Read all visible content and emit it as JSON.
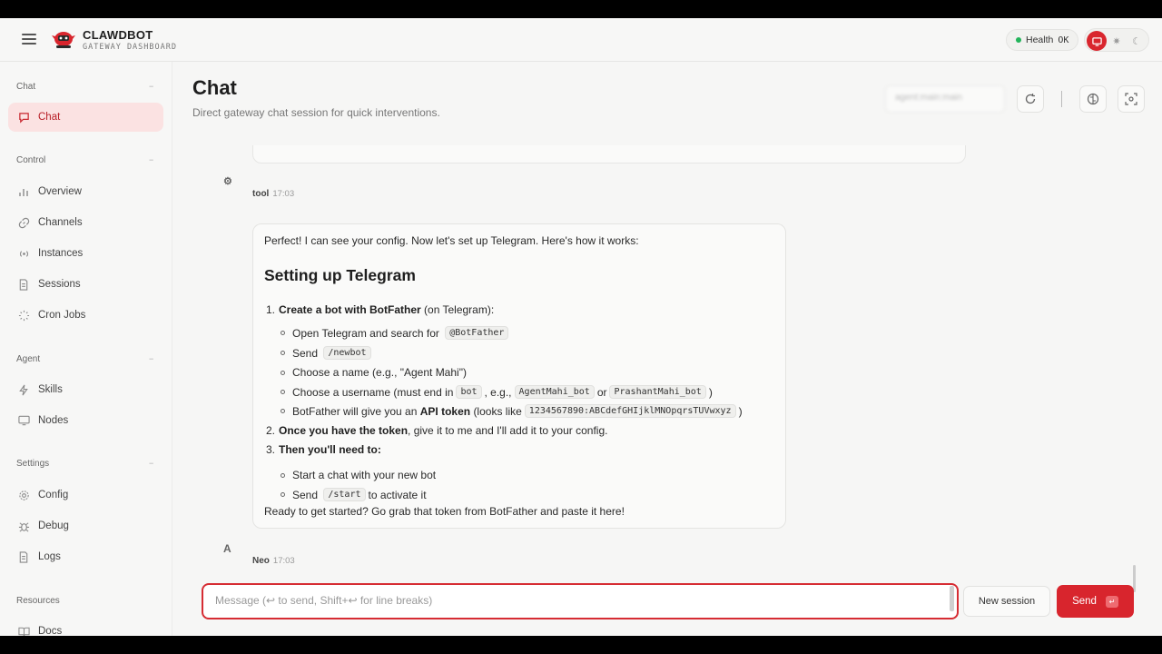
{
  "brand": {
    "title": "CLAWDBOT",
    "subtitle": "GATEWAY DASHBOARD"
  },
  "header": {
    "health_label": "Health",
    "health_status": "OK",
    "health_color": "#22b45a",
    "accent": "#d8252d"
  },
  "sidebar": {
    "groups": [
      {
        "label": "Chat",
        "items": [
          {
            "label": "Chat",
            "icon": "message-icon",
            "active": true
          }
        ]
      },
      {
        "label": "Control",
        "items": [
          {
            "label": "Overview",
            "icon": "bar-chart-icon"
          },
          {
            "label": "Channels",
            "icon": "link-icon"
          },
          {
            "label": "Instances",
            "icon": "radio-icon"
          },
          {
            "label": "Sessions",
            "icon": "document-icon"
          },
          {
            "label": "Cron Jobs",
            "icon": "loader-icon"
          }
        ]
      },
      {
        "label": "Agent",
        "items": [
          {
            "label": "Skills",
            "icon": "bolt-icon"
          },
          {
            "label": "Nodes",
            "icon": "monitor-icon"
          }
        ]
      },
      {
        "label": "Settings",
        "items": [
          {
            "label": "Config",
            "icon": "gear-icon"
          },
          {
            "label": "Debug",
            "icon": "bug-icon"
          },
          {
            "label": "Logs",
            "icon": "file-text-icon"
          }
        ]
      },
      {
        "label": "Resources",
        "items": [
          {
            "label": "Docs",
            "icon": "book-icon"
          }
        ]
      }
    ]
  },
  "main": {
    "title": "Chat",
    "subtitle": "Direct gateway chat session for quick interventions.",
    "session_key": "agent:main:main"
  },
  "messages": {
    "tool": {
      "avatar": "⚙",
      "sender": "tool",
      "time": "17:03"
    },
    "assistant": {
      "avatar": "A",
      "sender": "Neo",
      "time": "17:03",
      "intro": "Perfect! I can see your config. Now let's set up Telegram. Here's how it works:",
      "heading": "Setting up Telegram",
      "step1_num": "1.",
      "step1_bold": "Create a bot with BotFather",
      "step1_rest": "(on Telegram):",
      "s1a_text": "Open Telegram and search for",
      "s1a_code": "@BotFather",
      "s1b_text": "Send",
      "s1b_code": "/newbot",
      "s1c_text": "Choose a name (e.g., \"Agent Mahi\")",
      "s1d_text": "Choose a username (must end in",
      "s1d_code1": "bot",
      "s1d_mid": ", e.g.,",
      "s1d_code2": "AgentMahi_bot",
      "s1d_or": "or",
      "s1d_code3": "PrashantMahi_bot",
      "s1d_end": ")",
      "s1e_text": "BotFather will give you an",
      "s1e_bold": "API token",
      "s1e_mid": "(looks like",
      "s1e_code": "1234567890:ABCdefGHIjklMNOpqrsTUVwxyz",
      "s1e_end": ")",
      "step2_num": "2.",
      "step2_bold": "Once you have the token",
      "step2_rest": ", give it to me and I'll add it to your config.",
      "step3_num": "3.",
      "step3_bold": "Then you'll need to:",
      "s3a_text": "Start a chat with your new bot",
      "s3b_text": "Send",
      "s3b_code": "/start",
      "s3b_end": "to activate it",
      "outro": "Ready to get started? Go grab that token from BotFather and paste it here!"
    }
  },
  "composer": {
    "placeholder": "Message (↩ to send, Shift+↩ for line breaks)",
    "new_session_label": "New session",
    "send_label": "Send",
    "send_kbd": "↵"
  }
}
